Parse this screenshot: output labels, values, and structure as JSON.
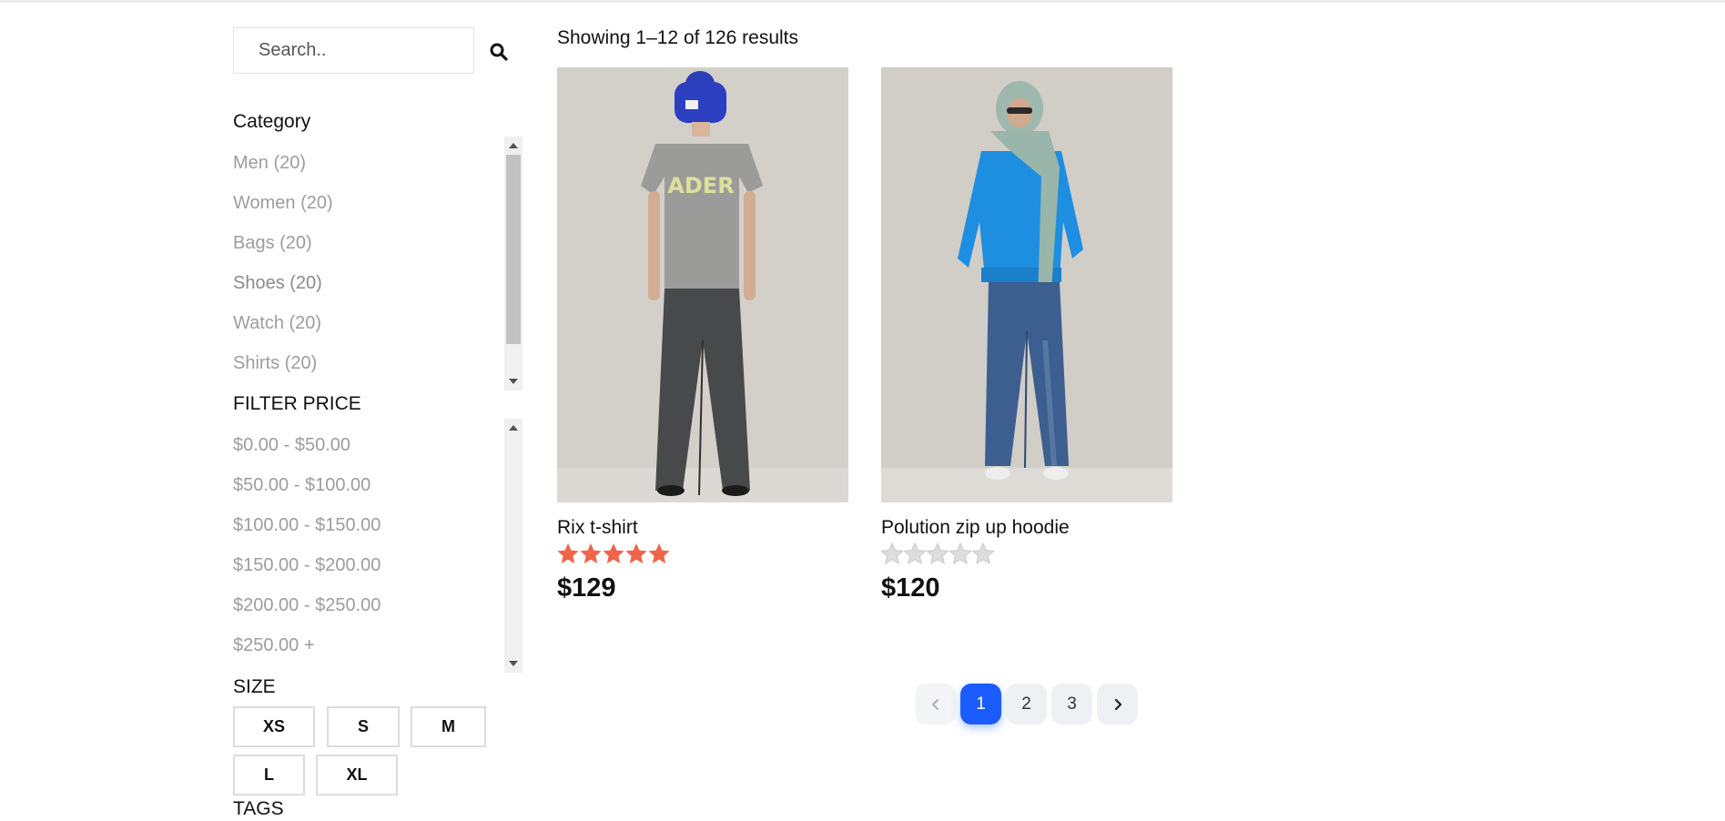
{
  "search": {
    "placeholder": "Search..",
    "icon": "search-icon"
  },
  "category": {
    "title": "Category",
    "items": [
      {
        "label": "Men (20)"
      },
      {
        "label": "Women (20)"
      },
      {
        "label": "Bags (20)"
      },
      {
        "label": "Shoes (20)"
      },
      {
        "label": "Watch (20)"
      },
      {
        "label": "Shirts (20)"
      }
    ]
  },
  "price_filter": {
    "title": "FILTER PRICE",
    "items": [
      {
        "label": "$0.00 - $50.00"
      },
      {
        "label": "$50.00 - $100.00"
      },
      {
        "label": "$100.00 - $150.00"
      },
      {
        "label": "$150.00 - $200.00"
      },
      {
        "label": "$200.00 - $250.00"
      },
      {
        "label": "$250.00 +"
      }
    ]
  },
  "size": {
    "title": "SIZE",
    "options": [
      "XS",
      "S",
      "M",
      "L",
      "XL"
    ]
  },
  "tags": {
    "title": "TAGS"
  },
  "results": {
    "summary": "Showing 1–12 of 126 results"
  },
  "products": [
    {
      "name": "Rix t-shirt",
      "price": "$129",
      "rating": 5,
      "max_rating": 5,
      "shirt_print": "ADER"
    },
    {
      "name": "Polution zip up hoodie",
      "price": "$120",
      "rating": 0,
      "max_rating": 5
    }
  ],
  "pagination": {
    "pages": [
      "1",
      "2",
      "3"
    ],
    "current": "1",
    "prev_icon": "chevron-left-icon",
    "next_icon": "chevron-right-icon"
  },
  "colors": {
    "accent": "#1a5cff",
    "star_filled": "#f06449",
    "star_empty": "#dddddd",
    "muted_text": "#9d9d9d"
  }
}
